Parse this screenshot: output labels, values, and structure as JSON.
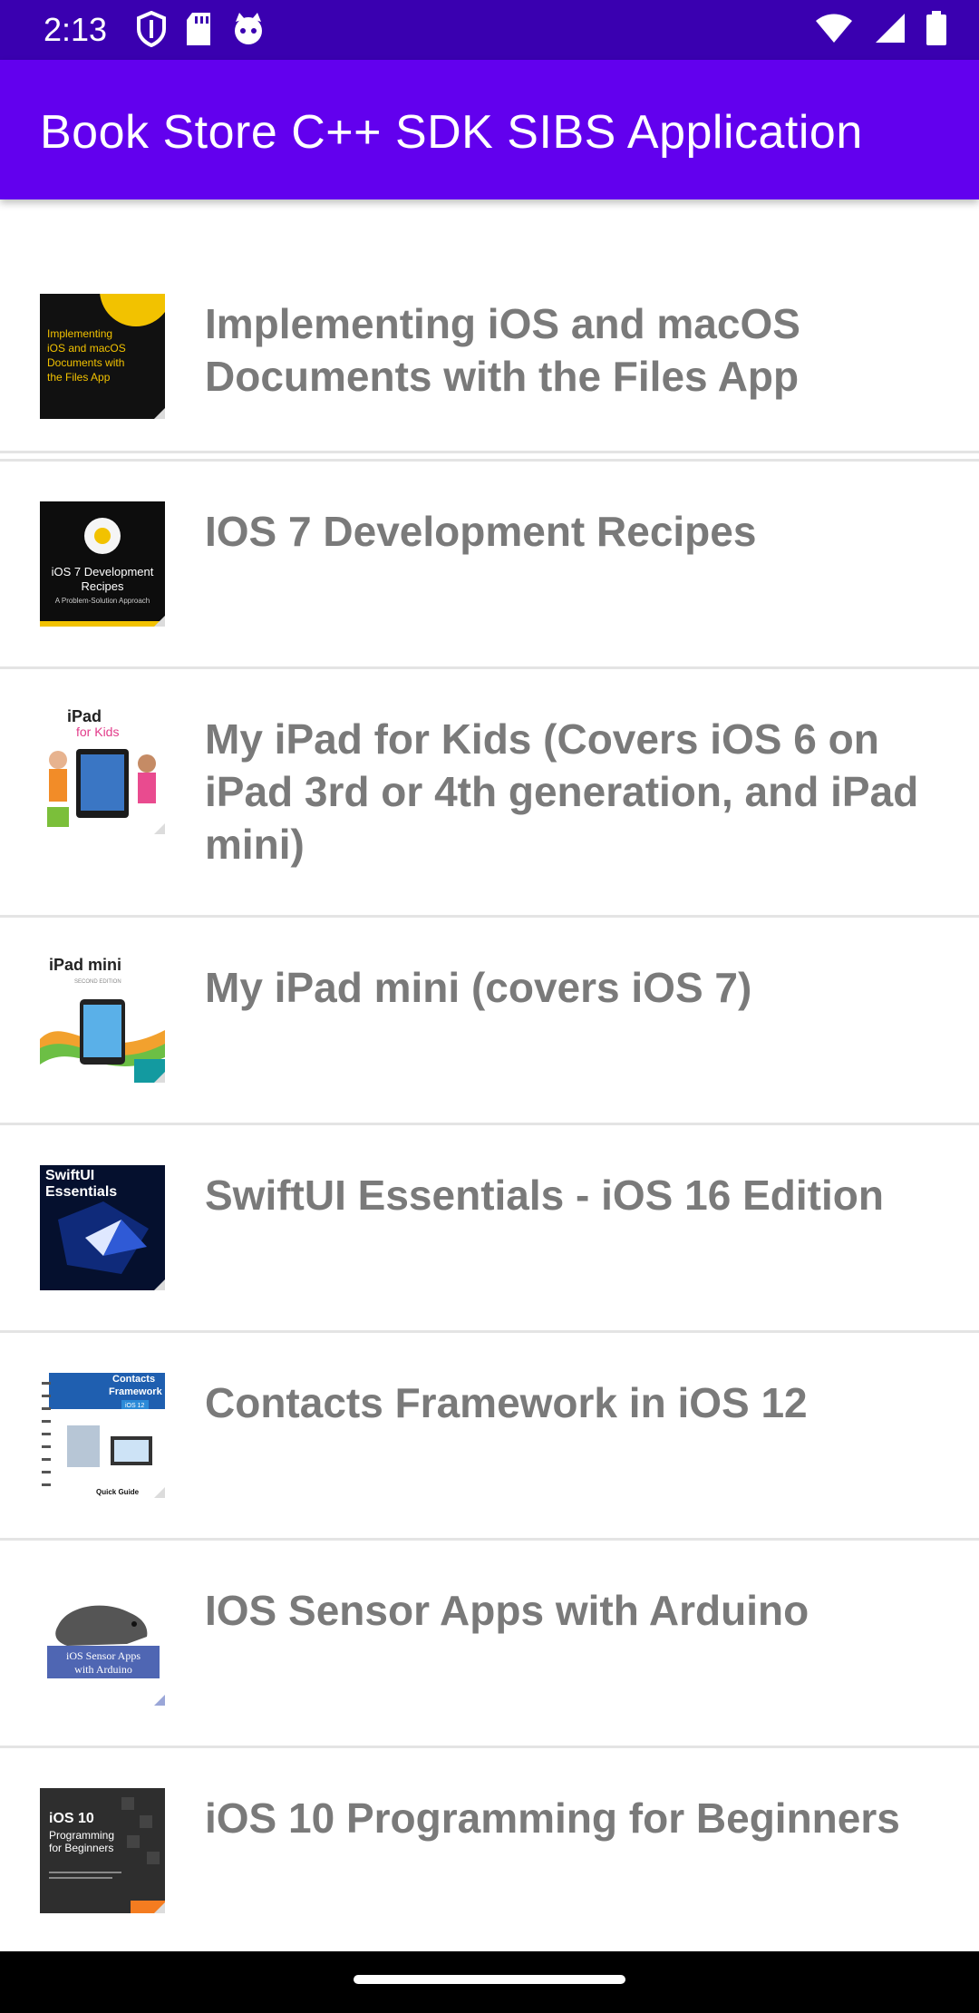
{
  "status_bar": {
    "time": "2:13",
    "icons_left": [
      "shield-icon",
      "sd-card-icon",
      "cat-icon"
    ],
    "icons_right": [
      "wifi-icon",
      "signal-icon",
      "battery-icon"
    ]
  },
  "app_bar": {
    "title": "Book Store C++ SDK SIBS Application",
    "color": "#6200ee"
  },
  "books": [
    {
      "title": "",
      "cover": "book-cover-partial"
    },
    {
      "title": "Implementing iOS and macOS Documents with the Files App",
      "cover": "book-cover-files-app"
    },
    {
      "title": "IOS 7 Development Recipes",
      "cover": "book-cover-ios7-recipes"
    },
    {
      "title": "My iPad for Kids (Covers iOS 6 on iPad 3rd or 4th generation, and iPad mini)",
      "cover": "book-cover-ipad-kids"
    },
    {
      "title": "My iPad mini (covers iOS 7)",
      "cover": "book-cover-ipad-mini"
    },
    {
      "title": "SwiftUI Essentials - iOS 16 Edition",
      "cover": "book-cover-swiftui"
    },
    {
      "title": "Contacts Framework in iOS 12",
      "cover": "book-cover-contacts"
    },
    {
      "title": "IOS Sensor Apps with Arduino",
      "cover": "book-cover-sensor-apps"
    },
    {
      "title": "iOS 10 Programming for Beginners",
      "cover": "book-cover-ios10"
    }
  ],
  "cover_text": {
    "files_app": [
      "Implementing",
      "iOS and macOS",
      "Documents with",
      "the Files App"
    ],
    "ios7": [
      "iOS 7 Development",
      "Recipes",
      "A Problem-Solution Approach"
    ],
    "ipad_kids": [
      "iPad",
      "for Kids"
    ],
    "ipad_mini": [
      "iPad mini",
      "SECOND EDITION"
    ],
    "swiftui": [
      "SwiftUI",
      "Essentials"
    ],
    "contacts": [
      "Contacts",
      "Framework",
      "iOS 12",
      "Quick Guide"
    ],
    "sensor": [
      "iOS Sensor Apps",
      "with Arduino"
    ],
    "ios10": [
      "iOS 10",
      "Programming",
      "for Beginners"
    ]
  }
}
